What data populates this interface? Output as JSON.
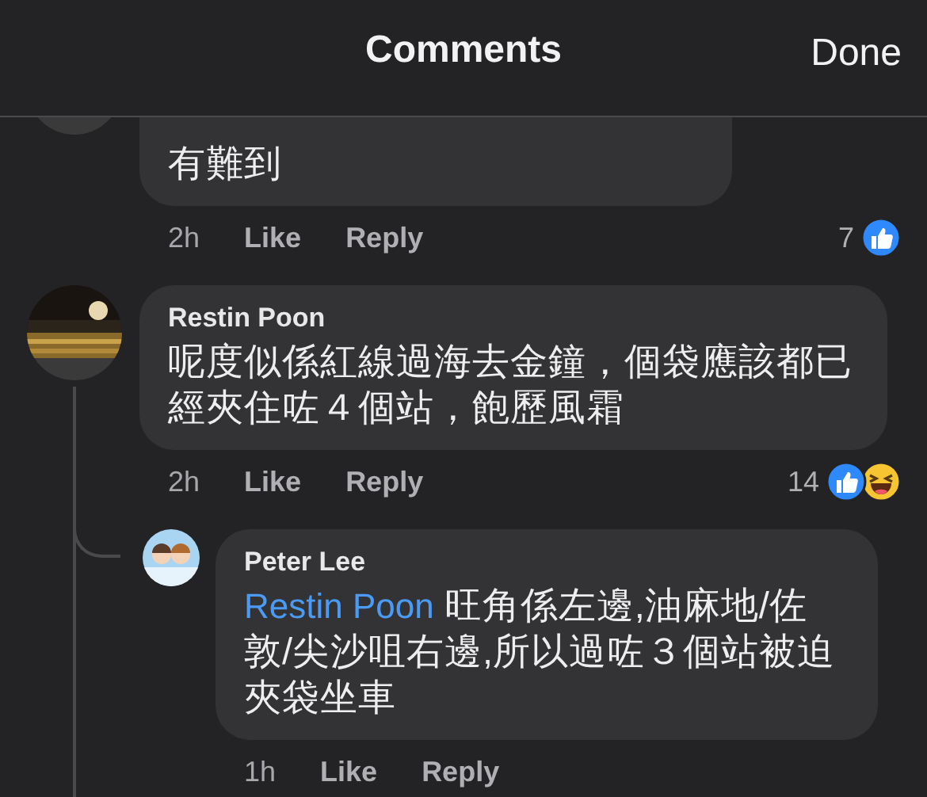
{
  "header": {
    "title": "Comments",
    "done": "Done"
  },
  "comments": [
    {
      "text": "有難到",
      "time": "2h",
      "like": "Like",
      "reply": "Reply",
      "count": "7",
      "reactions": [
        {
          "kind": "like"
        }
      ]
    },
    {
      "author": "Restin Poon",
      "text": "呢度似係紅線過海去金鐘，個袋應該都已經夾住咗４個站，飽歷風霜",
      "time": "2h",
      "like": "Like",
      "reply": "Reply",
      "count": "14",
      "reactions": [
        {
          "kind": "like"
        },
        {
          "kind": "haha"
        }
      ],
      "replies": [
        {
          "author": "Peter Lee",
          "mention": "Restin Poon",
          "text": "旺角係左邊,油麻地/佐敦/尖沙咀右邊,所以過咗３個站被迫夾袋坐車",
          "time": "1h",
          "like": "Like",
          "reply": "Reply"
        }
      ]
    }
  ]
}
